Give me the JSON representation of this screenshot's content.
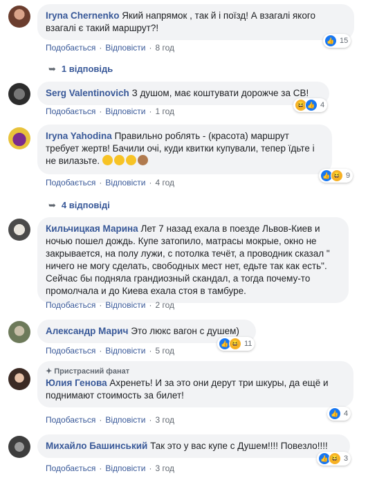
{
  "actions": {
    "like": "Подобається",
    "reply": "Відповісти"
  },
  "comments": [
    {
      "author": "Iryna Chernenko",
      "text": "Який напрямок , так й і поїзд! А взагалі якого взагалі є такий маршрут?!",
      "time": "8 год",
      "reactions": "15"
    },
    {
      "author": "Serg Valentinovich",
      "text": "З душом, має коштувати дорожче за СВ!",
      "time": "1 год",
      "reactions": "4"
    },
    {
      "author": "Iryna Yahodina",
      "text": "Правильно роблять - (красота) маршрут требует жертв! Бачили очі, куди квитки купували, тепер їдьте і не вилазьте.",
      "emojis": [
        "face-with-tears-of-joy",
        "face-with-tears-of-joy",
        "face-with-tears-of-joy",
        "see-no-evil-monkey"
      ],
      "time": "4 год",
      "reactions": "9"
    },
    {
      "author": "Кильчицкая Марина",
      "text": "Лет 7 назад ехала в поезде Львов-Киев и ночью пошел дождь. Купе затопило, матрасы мокрые, окно не закрывается, на полу лужи, с потолка течёт, а проводник сказал \" ничего не могу сделать, свободных мест нет, едьте так как есть\". Сейчас бы подняла грандиозный скандал, а тогда почему-то промолчала и до Киева ехала стоя в тамбуре.",
      "time": "2 год"
    },
    {
      "author": "Александр Марич",
      "text": "Это люкс вагон с душем)",
      "time": "5 год",
      "reactions": "11"
    },
    {
      "badge": "Пристрасний фанат",
      "author": "Юлия Генова",
      "text": "Ахренеть! И за это они дерут три шкуры, да ещё и поднимают стоимость за билет!",
      "time": "3 год",
      "reactions": "4"
    },
    {
      "author": "Михайло Башинський",
      "text": "Так это у вас купе с Душем!!!! Повезло!!!!",
      "time": "3 год",
      "reactions": "3"
    }
  ],
  "replies": [
    {
      "label": "1 відповідь"
    },
    {
      "label": "4 відповіді"
    }
  ]
}
